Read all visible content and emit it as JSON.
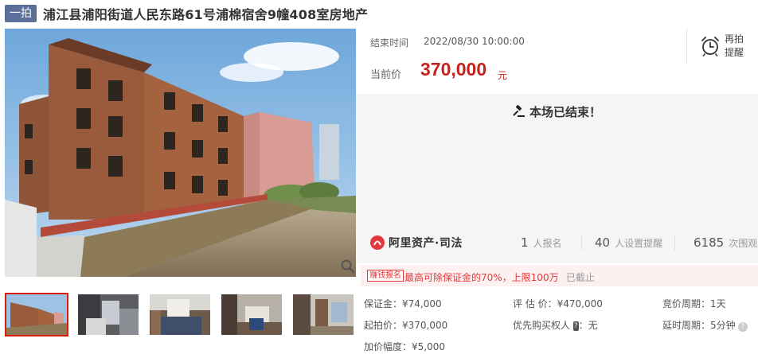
{
  "header": {
    "badge": "一拍",
    "title": "浦江县浦阳街道人民东路61号浦棉宿舍9幢408室房地产"
  },
  "gallery": {
    "main_image": "photo of red-brick residential buildings beside a canal",
    "thumbnails": [
      "building-exterior",
      "interior-kitchen",
      "interior-bedroom",
      "interior-room",
      "interior-hallway"
    ],
    "selected_index": 0
  },
  "auction": {
    "end_label": "结束时间",
    "end_time": "2022/08/30 10:00:00",
    "current_label": "当前价",
    "current_price": "370,000",
    "current_unit": "元",
    "remind_label": "再拍提醒",
    "ended_message": "本场已结束！"
  },
  "stats": {
    "platform": "阿里资产·司法",
    "signups_num": "1",
    "signups_label": "人报名",
    "reminders_num": "40",
    "reminders_label": "人设置提醒",
    "views_num": "6185",
    "views_label": "次围观"
  },
  "deposit_notice": {
    "tag": "赚钱报名",
    "text": "最高可除保证金的70%，上限100万",
    "status": "已截止"
  },
  "details": {
    "deposit": "保证金：¥74,000",
    "appraisal": "评 估 价：¥470,000",
    "cycle": "竞价周期：1天",
    "start_price": "起拍价：¥370,000",
    "priority_label": "优先购买权人",
    "priority_tag": "?",
    "priority_value": "：无",
    "delay": "延时周期：5分钟",
    "increment": "加价幅度：¥5,000"
  },
  "colors": {
    "badge": "#5a6f99",
    "price": "#c5221f",
    "thumb_active_border": "#d81e06",
    "notice_bg": "#fdf0f0"
  }
}
